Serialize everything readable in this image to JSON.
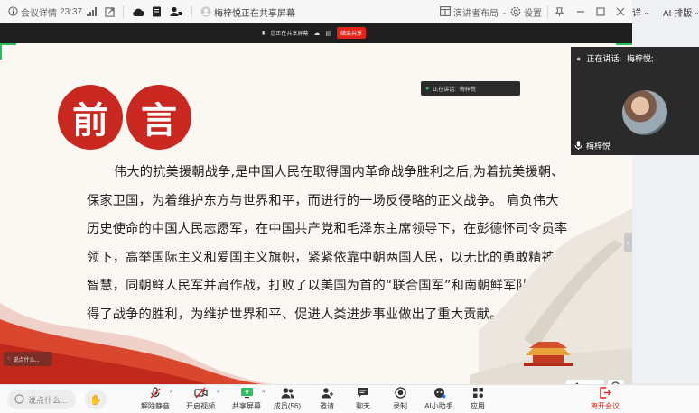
{
  "titlebar": {
    "meeting_info": "会议详情",
    "timer": "23:37",
    "sharing_status": "梅梓悦正在共享屏幕",
    "layout_label": "演讲者布局",
    "settings_label": "设置",
    "right_cut": "详",
    "ai_layout": "AI 排版"
  },
  "share_bar": {
    "status": "您正在共享屏幕",
    "stop_label": "结束共享"
  },
  "mini_speaker": {
    "label": "正在讲话:",
    "name": "梅梓悦"
  },
  "slide": {
    "title_char_1": "前",
    "title_char_2": "言",
    "lines": [
      "伟大的抗美援朝战争,是中国人民在取得国内革命战争胜利之后,为着抗美援朝、",
      "保家卫国，为着维护东方与世界和平，而进行的一场反侵略的正义战争。   肩负伟大",
      "历史使命的中国人民志愿军，在中国共产党和毛泽东主席领导下，在彭德怀司令员率",
      "领下，高举国际主义和爱国主义旗帜，紧紧依靠中朝两国人民，以无比的勇敢精神和",
      "智慧，同朝鲜人民军并肩作战，打败了以美国为首的“联合国军”和南朝鲜军队，赢",
      "得了战争的胜利，为维护世界和平、促进人类进步事业做出了重大贡献。"
    ],
    "comment_hint": "说点什么...",
    "annotate_label": "批注"
  },
  "video": {
    "speaking_label": "正在讲话:",
    "speaking_name": "梅梓悦;",
    "tile_name": "梅梓悦"
  },
  "toolbar": {
    "say_placeholder": "说点什么...",
    "items": [
      {
        "label": "解除静音"
      },
      {
        "label": "开启视频"
      },
      {
        "label": "共享屏幕"
      },
      {
        "label": "成员(56)"
      },
      {
        "label": "邀请"
      },
      {
        "label": "聊天"
      },
      {
        "label": "录制"
      },
      {
        "label": "AI小助手"
      },
      {
        "label": "应用"
      },
      {
        "label": "离开会议"
      }
    ]
  },
  "colors": {
    "accent_red": "#c8281f",
    "leave_red": "#e2231a",
    "share_green": "#25c05a"
  }
}
